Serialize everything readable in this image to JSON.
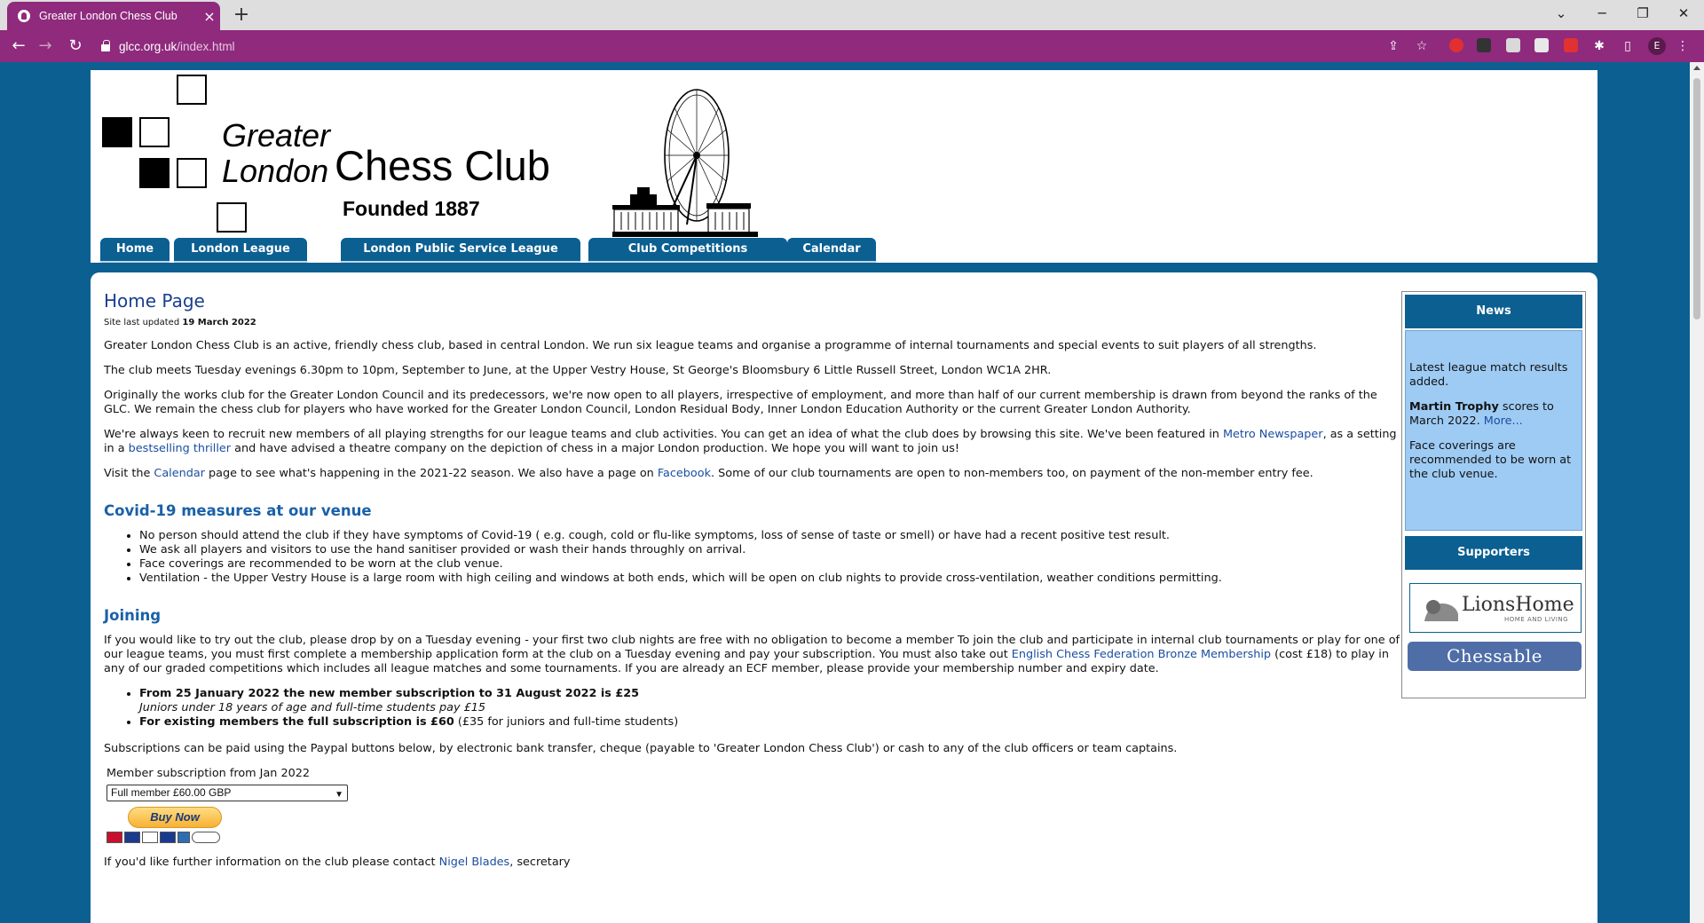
{
  "browser": {
    "tab_title": "Greater London Chess Club",
    "tab_close": "×",
    "new_tab": "+",
    "url_host": "glcc.org.uk",
    "url_path": "/index.html",
    "profile_initial": "E",
    "accent": "#8f2a7d"
  },
  "site": {
    "logo_greater": "Greater",
    "logo_london": "London",
    "logo_chess_club": "Chess Club",
    "logo_founded": "Founded 1887",
    "brand_blue": "#0b5f91"
  },
  "nav": {
    "home": "Home",
    "london_league": "London League",
    "public_service": "London Public Service League",
    "club_competitions": "Club Competitions",
    "calendar": "Calendar"
  },
  "main": {
    "title": "Home Page",
    "updated_prefix": "Site last updated ",
    "updated_date": "19 March 2022",
    "p1": "Greater London Chess Club is an active, friendly chess club, based in central London. We run six league teams and organise a programme of internal tournaments and special events to suit players of all strengths.",
    "p2": "The club meets Tuesday evenings 6.30pm to 10pm, September to June, at the Upper Vestry House, St George's Bloomsbury 6 Little Russell Street, London WC1A 2HR.",
    "p3": "Originally the works club for the Greater London Council and its predecessors, we're now open to all players, irrespective of employment, and more than half of our current membership is drawn from beyond the ranks of the GLC. We remain the chess club for players who have worked for the Greater London Council, London Residual Body, Inner London Education Authority or the current Greater London Authority.",
    "p4_a": "We're always keen to recruit new members of all playing strengths for our league teams and club activities. You can get an idea of what the club does by browsing this site. We've been featured in ",
    "p4_link1": "Metro Newspaper",
    "p4_b": ", as a setting in a ",
    "p4_link2": "bestselling thriller",
    "p4_c": " and have advised a theatre company on the depiction of chess in a major London production. We hope you will want to join us!",
    "p5_a": "Visit the ",
    "p5_link1": "Calendar",
    "p5_b": " page to see what's happening in the 2021-22 season. We also have a page on ",
    "p5_link2": "Facebook",
    "p5_c": ". Some of our club tournaments are open to non-members too, on payment of the non-member entry fee.",
    "covid_heading": "Covid-19 measures at our venue",
    "covid_items": [
      "No person should attend the club if they have symptoms of Covid-19 ( e.g. cough, cold or flu-like symptoms, loss of sense of taste or smell) or have had a recent positive test result.",
      "We ask all players and visitors to use the hand sanitiser provided or wash their hands throughly on arrival.",
      "Face coverings are recommended to be worn at the club venue.",
      "Ventilation - the Upper Vestry House is a large room with high ceiling and windows at both ends, which will be open on club nights to provide cross-ventilation, weather conditions permitting."
    ],
    "joining_heading": "Joining",
    "join_a": "If you would like to try out the club, please drop by on a Tuesday evening - your first two club nights are free with no obligation to become a member To join the club and participate in internal club tournaments or play for one of our league teams, you must first complete a membership application form at the club on a Tuesday evening and pay your subscription. You must also take out ",
    "join_link": "English Chess Federation Bronze Membership",
    "join_b": " (cost £18) to play in any of our graded competitions which includes all league matches and some tournaments. If you are already an ECF member, please provide your membership number and expiry date.",
    "fee1_bold": "From 25 January 2022 the new member subscription to 31 August 2022 is £25",
    "fee1_sub": "Juniors under 18 years of age and full-time students pay £15",
    "fee2_bold": "For existing members the full subscription is £60",
    "fee2_rest": " (£35 for juniors and full-time students)",
    "pay_text": "Subscriptions can be paid using the Paypal buttons below, by electronic bank transfer, cheque (payable to 'Greater London Chess Club') or cash to any of the club officers or team captains.",
    "select_label": "Member subscription from Jan 2022",
    "select_value": "Full member £60.00 GBP",
    "buy_now": "Buy Now",
    "contact_a": "If you'd like further information on the club please contact ",
    "contact_link": "Nigel Blades",
    "contact_b": ", secretary"
  },
  "sidebar": {
    "news_heading": "News",
    "news1": "Latest league match results added.",
    "news2_bold": "Martin Trophy",
    "news2_rest": " scores to March 2022. ",
    "news2_link": "More...",
    "news3": "Face coverings are recommended to be worn at the club venue.",
    "supporters_heading": "Supporters",
    "lions_name": "LionsHome",
    "lions_sub": "HOME AND LIVING",
    "chessable_name": "Chessable"
  }
}
